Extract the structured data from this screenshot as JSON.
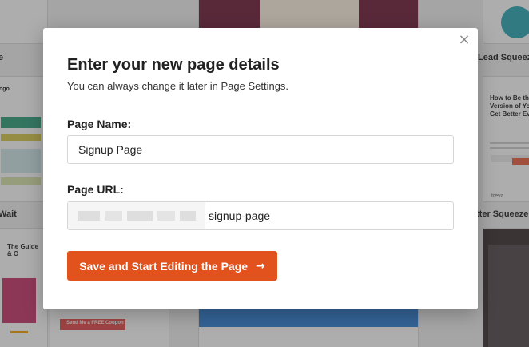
{
  "modal": {
    "title": "Enter your new page details",
    "subtitle": "You can always change it later in Page Settings.",
    "page_name_label": "Page Name:",
    "page_name_value": "Signup Page",
    "page_url_label": "Page URL:",
    "page_url_value": "signup-page",
    "submit_label": "Save and Start Editing the Page",
    "submit_arrow": "→",
    "close_glyph": "×"
  },
  "background": {
    "labels": {
      "left_top": "e",
      "left_mid": "ogo",
      "left_bottom": "Wait",
      "left_bottom_heading": "The Guide & O",
      "right_top": "Lead Squeeze",
      "right_mid_heading": "How to Be the Version of Yo Get Better Ev",
      "right_mid_brand": "treva.",
      "right_bottom": "tter Squeeze",
      "center_bottom_cta": "Send Me a FREE Coupon"
    }
  },
  "colors": {
    "accent": "#e2521d",
    "overlay": "rgba(60,60,60,0.42)"
  },
  "icons": [
    "close-icon",
    "arrow-right-icon"
  ]
}
